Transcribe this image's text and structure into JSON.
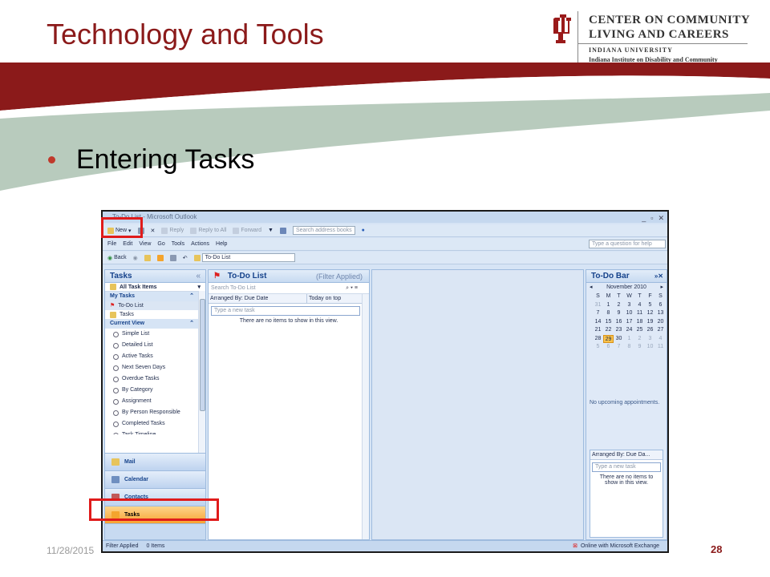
{
  "slide": {
    "title": "Technology and Tools",
    "bullet": "Entering Tasks",
    "date": "11/28/2015",
    "page": "28"
  },
  "logo": {
    "line1": "CENTER ON COMMUNITY",
    "line2": "LIVING AND CAREERS",
    "line3": "INDIANA UNIVERSITY",
    "line4": "Indiana Institute on Disability and Community"
  },
  "colors": {
    "brand_crimson": "#8b1a1a",
    "highlight_red": "#e01b1b",
    "outlook_blue": "#d6e4f5",
    "active_tasks_orange": "#f7a332"
  },
  "outlook": {
    "window_title": "To-Do List - Microsoft Outlook",
    "toolbar1": {
      "new": "New",
      "reply": "Reply",
      "reply_all": "Reply to All",
      "forward": "Forward",
      "address_search": "Search address books"
    },
    "menu": [
      "File",
      "Edit",
      "View",
      "Go",
      "Tools",
      "Actions",
      "Help"
    ],
    "help_search": "Type a question for help",
    "toolbar3": {
      "back": "Back",
      "folder_select": "To-Do List"
    },
    "nav": {
      "title": "Tasks",
      "all_items": "All Task Items",
      "my_tasks_header": "My Tasks",
      "my_tasks": [
        "To-Do List",
        "Tasks"
      ],
      "current_view_header": "Current View",
      "views": [
        "Simple List",
        "Detailed List",
        "Active Tasks",
        "Next Seven Days",
        "Overdue Tasks",
        "By Category",
        "Assignment",
        "By Person Responsible",
        "Completed Tasks",
        "Task Timeline"
      ],
      "buttons": [
        "Mail",
        "Calendar",
        "Contacts",
        "Tasks"
      ]
    },
    "todo_list": {
      "title": "To-Do List",
      "filter": "(Filter Applied)",
      "search_placeholder": "Search To-Do List",
      "col_arranged": "Arranged By: Due Date",
      "col_sort": "Today on top",
      "new_task_placeholder": "Type a new task",
      "empty_message": "There are no items to show in this view."
    },
    "todo_bar": {
      "title": "To-Do Bar",
      "month": "November 2010",
      "weekdays": [
        "S",
        "M",
        "T",
        "W",
        "T",
        "F",
        "S"
      ],
      "days": [
        [
          "31",
          "1",
          "2",
          "3",
          "4",
          "5",
          "6"
        ],
        [
          "7",
          "8",
          "9",
          "10",
          "11",
          "12",
          "13"
        ],
        [
          "14",
          "15",
          "16",
          "17",
          "18",
          "19",
          "20"
        ],
        [
          "21",
          "22",
          "23",
          "24",
          "25",
          "26",
          "27"
        ],
        [
          "28",
          "29",
          "30",
          "1",
          "2",
          "3",
          "4"
        ],
        [
          "5",
          "6",
          "7",
          "8",
          "9",
          "10",
          "11"
        ]
      ],
      "today": "29",
      "no_appointments": "No upcoming appointments.",
      "tasks_header": "Arranged By: Due Da...",
      "new_task_placeholder": "Type a new task",
      "empty_message": "There are no items to show in this view."
    },
    "status": {
      "filter": "Filter Applied",
      "count": "0 Items",
      "connection": "Online with Microsoft Exchange"
    }
  }
}
